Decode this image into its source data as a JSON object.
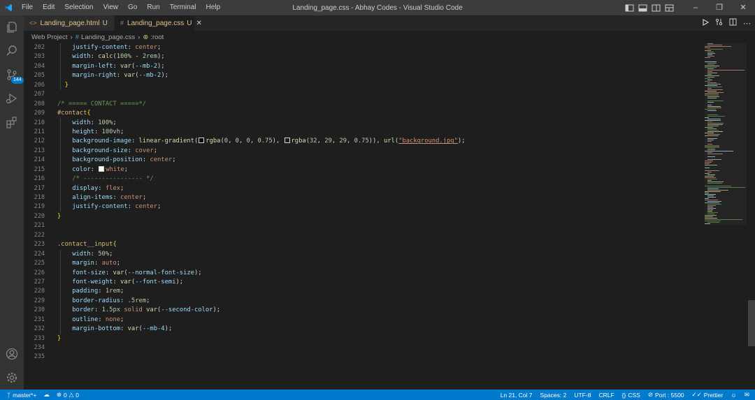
{
  "titlebar": {
    "menu": [
      "File",
      "Edit",
      "Selection",
      "View",
      "Go",
      "Run",
      "Terminal",
      "Help"
    ],
    "title": "Landing_page.css - Abhay Codes - Visual Studio Code"
  },
  "activity": {
    "scm_badge": "144"
  },
  "tabs": [
    {
      "label": "Landing_page.html",
      "status": "U",
      "icon": "html-file-icon",
      "active": false
    },
    {
      "label": "Landing_page.css",
      "status": "U",
      "icon": "css-file-icon",
      "active": true
    }
  ],
  "breadcrumb": {
    "folder": "Web Project",
    "file": "Landing_page.css",
    "symbol": ":root"
  },
  "editor": {
    "line_numbers": [
      "202",
      "203",
      "204",
      "205",
      "206",
      "207",
      "208",
      "209",
      "210",
      "211",
      "212",
      "213",
      "214",
      "215",
      "216",
      "217",
      "218",
      "219",
      "220",
      "221",
      "222",
      "223",
      "224",
      "225",
      "226",
      "227",
      "228",
      "229",
      "230",
      "231",
      "232",
      "233",
      "234",
      "235"
    ],
    "css_selector_contact": "#contact",
    "css_selector_input": ".contact__input",
    "comment_contact": "/* ===== CONTACT =====*/",
    "comment_dashes": "/* ---------------- */",
    "bg_image_url": "\"background.jpg\""
  },
  "statusbar": {
    "branch": "master*+",
    "errors": "0",
    "warnings": "0",
    "position": "Ln 21, Col 7",
    "spaces": "Spaces: 2",
    "encoding": "UTF-8",
    "eol": "CRLF",
    "language": "CSS",
    "port": "Port : 5500",
    "prettier": "Prettier"
  },
  "colors": {
    "accent": "#007acc",
    "titlebar": "#3c3c3c",
    "editor_bg": "#1e1e1e"
  }
}
